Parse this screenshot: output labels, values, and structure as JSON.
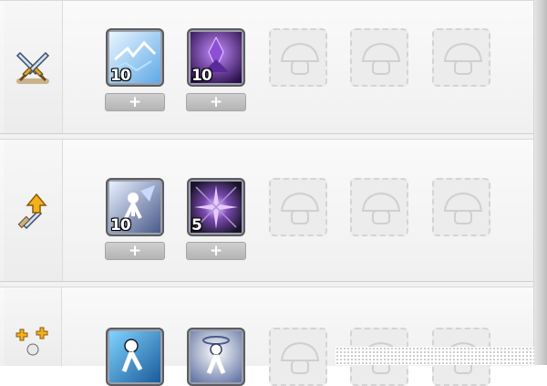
{
  "skill_panel": {
    "rows": [
      {
        "category_icon": "crossed-swords-icon",
        "slots": [
          {
            "type": "skill",
            "icon": "ice-shards-skill-icon",
            "level": "10"
          },
          {
            "type": "skill",
            "icon": "purple-crystal-skill-icon",
            "level": "10"
          },
          {
            "type": "empty"
          },
          {
            "type": "empty"
          },
          {
            "type": "empty"
          }
        ],
        "plus_label": "+"
      },
      {
        "category_icon": "sword-upgrade-icon",
        "slots": [
          {
            "type": "skill",
            "icon": "winged-warrior-skill-icon",
            "level": "10"
          },
          {
            "type": "skill",
            "icon": "dark-starburst-skill-icon",
            "level": "5"
          },
          {
            "type": "empty"
          },
          {
            "type": "empty"
          },
          {
            "type": "empty"
          }
        ],
        "plus_label": "+"
      },
      {
        "category_icon": "party-buff-icon",
        "slots": [
          {
            "type": "skill",
            "icon": "blue-figure-skill-icon",
            "level": ""
          },
          {
            "type": "skill",
            "icon": "halo-figure-skill-icon",
            "level": ""
          },
          {
            "type": "empty"
          },
          {
            "type": "empty"
          },
          {
            "type": "empty"
          }
        ]
      }
    ]
  }
}
